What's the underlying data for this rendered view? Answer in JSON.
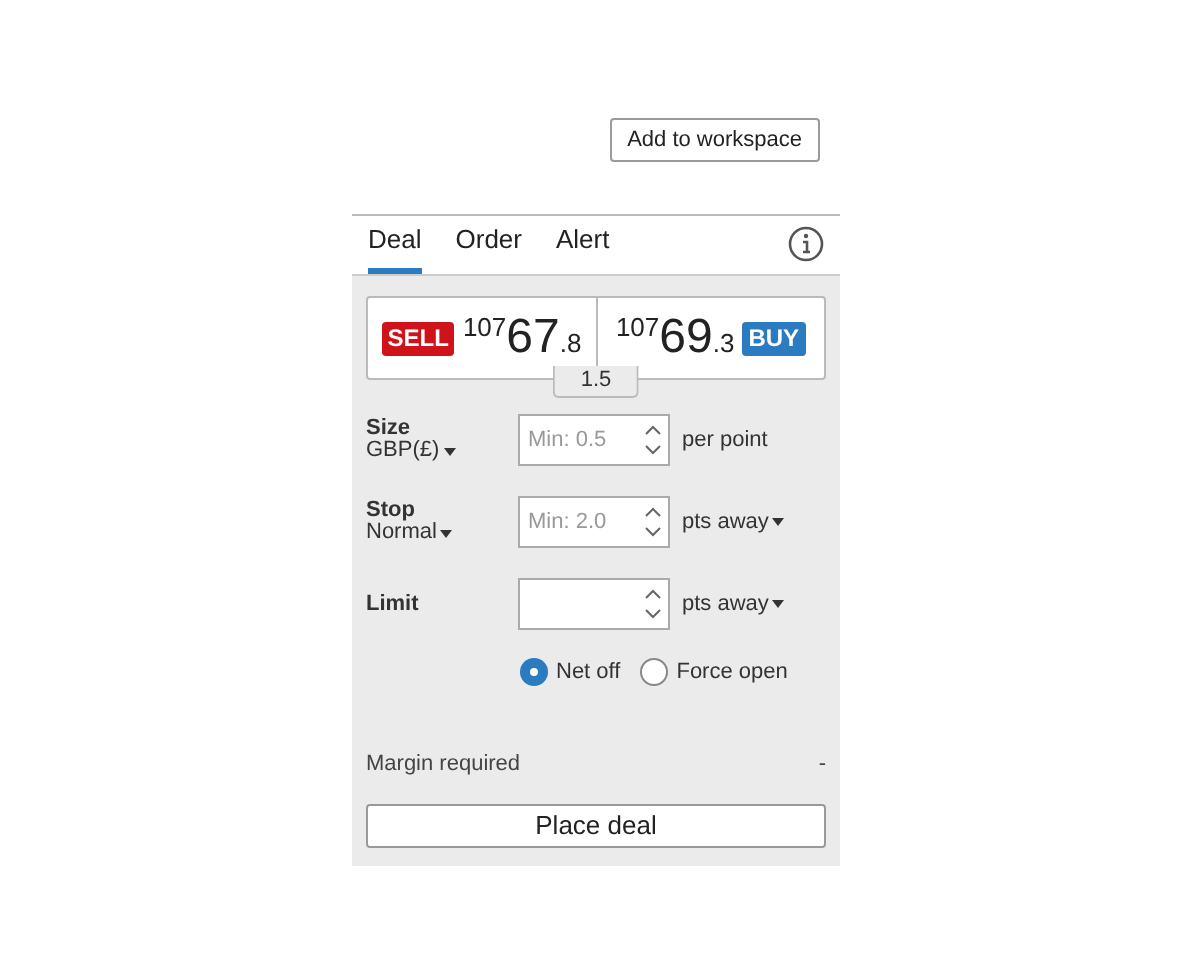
{
  "workspace_button": "Add to workspace",
  "tabs": [
    {
      "label": "Deal",
      "selected": true
    },
    {
      "label": "Order",
      "selected": false
    },
    {
      "label": "Alert",
      "selected": false
    }
  ],
  "prices": {
    "sell": {
      "badge": "SELL",
      "prefix": "107",
      "main": "67",
      "decimal": ".8"
    },
    "buy": {
      "badge": "BUY",
      "prefix": "107",
      "main": "69",
      "decimal": ".3"
    },
    "spread": "1.5"
  },
  "fields": [
    {
      "label": "Size",
      "sublabel": "GBP(£)",
      "placeholder": "Min: 0.5",
      "unit": "per point",
      "unit_dropdown": false
    },
    {
      "label": "Stop",
      "sublabel": "Normal",
      "placeholder": "Min: 2.0",
      "unit": "pts away",
      "unit_dropdown": true
    },
    {
      "label": "Limit",
      "unit": "pts away",
      "unit_dropdown": true
    }
  ],
  "radios": [
    {
      "label": "Net off",
      "selected": true
    },
    {
      "label": "Force open",
      "selected": false
    }
  ],
  "margin": {
    "label": "Margin required",
    "value": "-"
  },
  "submit_button": "Place deal"
}
